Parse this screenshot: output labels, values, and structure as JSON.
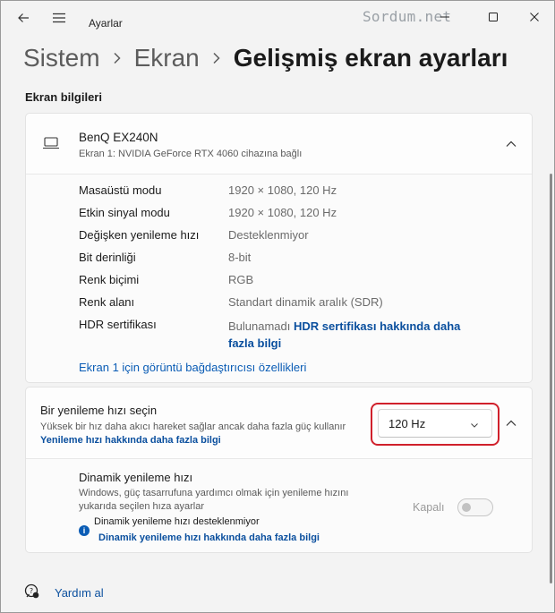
{
  "window": {
    "app_title": "Ayarlar",
    "watermark": "Sordum.net"
  },
  "breadcrumb": {
    "items": [
      "Sistem",
      "Ekran",
      "Gelişmiş ekran ayarları"
    ],
    "separator": ">"
  },
  "section_title": "Ekran bilgileri",
  "display": {
    "name": "BenQ EX240N",
    "subtitle": "Ekran 1: NVIDIA GeForce RTX 4060 cihazına bağlı",
    "rows": [
      {
        "label": "Masaüstü modu",
        "value": "1920 × 1080, 120 Hz"
      },
      {
        "label": "Etkin sinyal modu",
        "value": "1920 × 1080, 120 Hz"
      },
      {
        "label": "Değişken yenileme hızı",
        "value": "Desteklenmiyor"
      },
      {
        "label": "Bit derinliği",
        "value": "8-bit"
      },
      {
        "label": "Renk biçimi",
        "value": "RGB"
      },
      {
        "label": "Renk alanı",
        "value": "Standart dinamik aralık (SDR)"
      }
    ],
    "hdr": {
      "label": "HDR sertifikası",
      "value": "Bulunamadı",
      "link": "HDR sertifikası hakkında daha fazla bilgi"
    },
    "adapter_link": "Ekran 1 için görüntü bağdaştırıcısı özellikleri"
  },
  "refresh": {
    "title": "Bir yenileme hızı seçin",
    "description": "Yüksek bir hız daha akıcı hareket sağlar ancak daha fazla güç kullanır",
    "link": "Yenileme hızı hakkında daha fazla bilgi",
    "selected": "120 Hz",
    "highlight_color": "#d0202b"
  },
  "dynamic": {
    "title": "Dinamik yenileme hızı",
    "description": "Windows, güç tasarrufuna yardımcı olmak için yenileme hızını yukarıda seçilen hıza ayarlar",
    "unsupported": "Dinamik yenileme hızı desteklenmiyor",
    "link": "Dinamik yenileme hızı hakkında daha fazla bilgi",
    "toggle_label": "Kapalı",
    "toggle_on": false
  },
  "footer": {
    "help": "Yardım al"
  },
  "colors": {
    "accent_link": "#0a4f9e",
    "background": "#f3f3f3"
  }
}
